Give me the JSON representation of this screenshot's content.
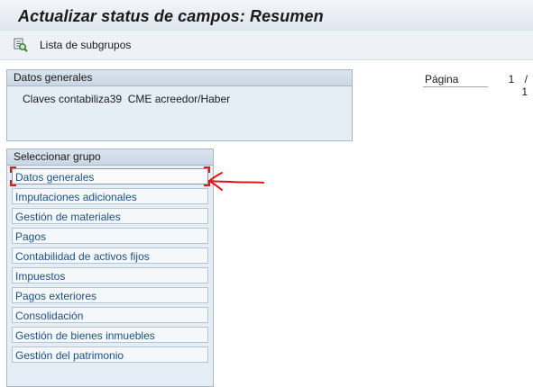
{
  "window": {
    "title": "Actualizar status de campos: Resumen"
  },
  "toolbar": {
    "button_label": "Lista de subgrupos",
    "button_icon": "magnifier-list-icon"
  },
  "general_panel": {
    "title": "Datos generales",
    "clave_label": "Claves contabiliza",
    "clave_value": "39",
    "clave_description": "CME acreedor/Haber"
  },
  "pagination": {
    "label": "Página",
    "value": "1 / 1"
  },
  "group_panel": {
    "title": "Seleccionar grupo",
    "items": [
      {
        "label": "Datos generales"
      },
      {
        "label": "Imputaciones adicionales"
      },
      {
        "label": "Gestión de materiales"
      },
      {
        "label": "Pagos"
      },
      {
        "label": "Contabilidad de activos fijos"
      },
      {
        "label": "Impuestos"
      },
      {
        "label": "Pagos exteriores"
      },
      {
        "label": "Consolidación"
      },
      {
        "label": "Gestión de bienes inmuebles"
      },
      {
        "label": "Gestión del patrimonio"
      }
    ]
  },
  "colors": {
    "focus_marker": "#d21e1e",
    "link_text": "#1a4f8a",
    "panel_bg": "#e6eef5"
  }
}
